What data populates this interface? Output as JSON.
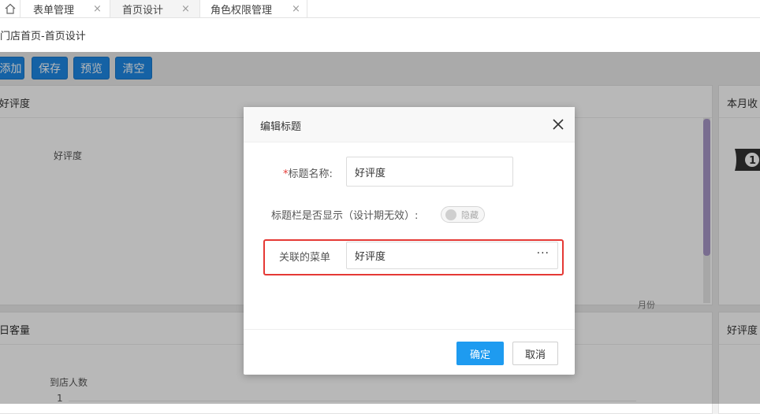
{
  "tabs": [
    {
      "label": "表单管理"
    },
    {
      "label": "首页设计"
    },
    {
      "label": "角色权限管理"
    }
  ],
  "tab_close_glyph": "×",
  "breadcrumb": "门店首页-首页设计",
  "toolbar": {
    "add": "添加",
    "save": "保存",
    "preview": "预览",
    "clear": "清空"
  },
  "cards": {
    "good_rating_title": "好评度",
    "good_rating_inner": "好评度",
    "monthly_income_title": "本月收",
    "daily_visits_title": "日客量",
    "visitors_label": "到店人数",
    "axis_tick": "1",
    "good_rating_title_2": "好评度",
    "month_label": "月份"
  },
  "dialog": {
    "title": "编辑标题",
    "title_name_label": "标题名称:",
    "required_mark": "*",
    "title_name_value": "好评度",
    "show_label": "标题栏是否显示（设计期无效）:",
    "toggle_text": "隐藏",
    "menu_label": "关联的菜单",
    "menu_value": "好评度",
    "more_glyph": "···",
    "ok": "确定",
    "cancel": "取消"
  },
  "colors": {
    "primary": "#1e88e5",
    "ok_button": "#1e9bf0",
    "highlight": "#e53935"
  }
}
